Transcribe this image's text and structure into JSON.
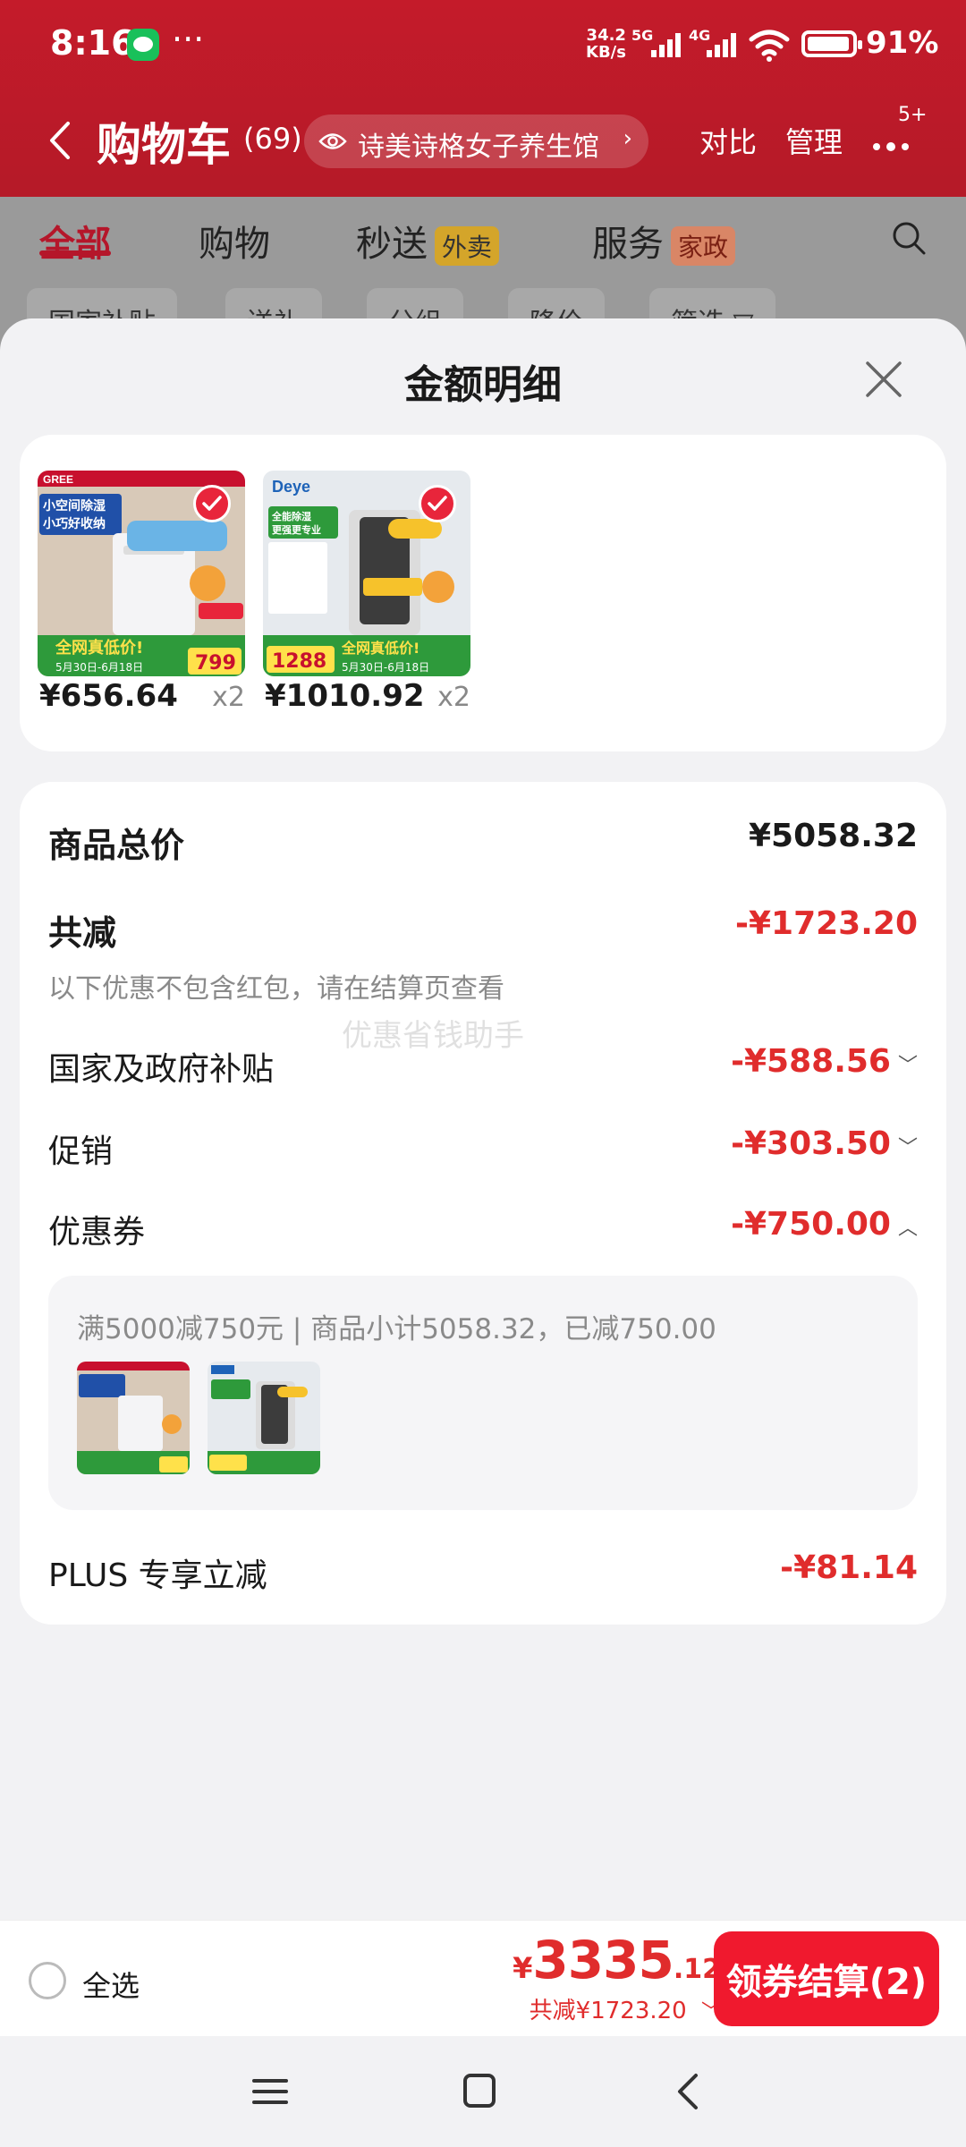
{
  "status_bar": {
    "time": "8:16",
    "more": "···",
    "net_speed_top": "34.2",
    "net_speed_bottom": "KB/s",
    "sig1": "5G",
    "sig2": "4G",
    "battery": "91%"
  },
  "nav": {
    "title": "购物车",
    "count": "(69)",
    "store": "诗美诗格女子养生馆",
    "compare": "对比",
    "manage": "管理",
    "more_badge": "5+"
  },
  "tabs": [
    {
      "label": "全部",
      "active": true
    },
    {
      "label": "购物"
    },
    {
      "label": "秒送",
      "badge": "外卖"
    },
    {
      "label": "服务",
      "badge": "家政"
    }
  ],
  "filter_chips": [
    "国家补贴",
    "送礼",
    "分组",
    "降价",
    "筛选 ▽"
  ],
  "sheet": {
    "title": "金额明细",
    "products": [
      {
        "price": "¥656.64",
        "qty": "x2",
        "brand": "GREE",
        "img_lines": [
          "小空间除湿",
          "小巧好收纳"
        ],
        "deal": "全网真低价!",
        "dates": "5月30日-6月18日",
        "tag_price": "799"
      },
      {
        "price": "¥1010.92",
        "qty": "x2",
        "brand": "Deye",
        "img_lines": [
          "全能除湿",
          "更强更专业"
        ],
        "deal": "全网真低价!",
        "dates": "5月30日-6月18日",
        "tag_price": "1288"
      }
    ],
    "details": {
      "total_label": "商品总价",
      "total_value": "¥5058.32",
      "reduce_label": "共减",
      "reduce_value": "-¥1723.20",
      "hint": "以下优惠不包含红包，请在结算页查看",
      "watermark": "优惠省钱助手",
      "gov_label": "国家及政府补贴",
      "gov_value": "-¥588.56",
      "promo_label": "促销",
      "promo_value": "-¥303.50",
      "coupon_label": "优惠券",
      "coupon_value": "-¥750.00",
      "coupon_text": "满5000减750元 | 商品小计5058.32，已减750.00",
      "plus_label": "PLUS 专享立减",
      "plus_value": "-¥81.14"
    }
  },
  "bottom_bar": {
    "select_all": "全选",
    "price_symbol": "¥",
    "price_int": "3335",
    "price_dec": ".12",
    "discount": "共减¥1723.20",
    "checkout": "领券结算(2)"
  },
  "colors": {
    "accent_red": "#e02c2c",
    "button_red": "#f0192e",
    "header_red": "#c41b2a"
  }
}
